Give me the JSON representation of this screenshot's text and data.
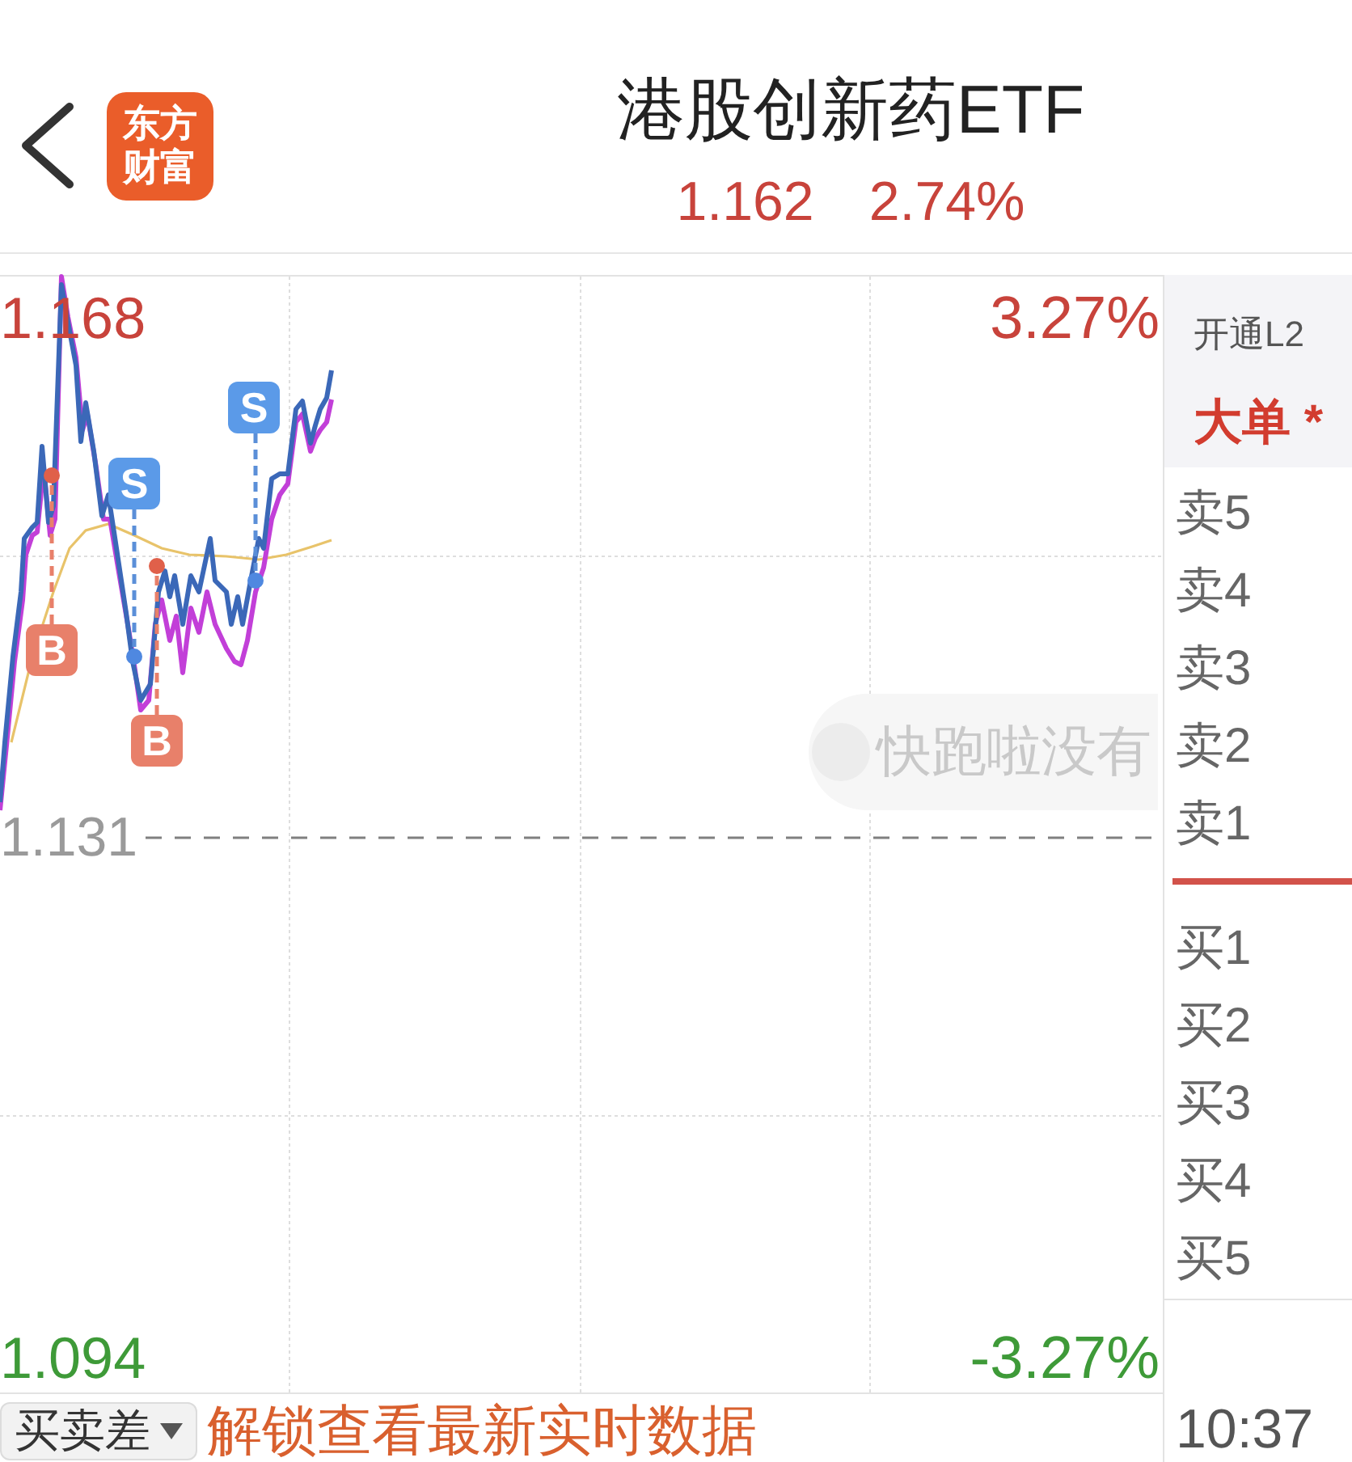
{
  "header": {
    "logo": {
      "lines": [
        "东方",
        "财富"
      ]
    },
    "title": "港股创新药ETF",
    "price": "1.162",
    "change_percent": "2.74%"
  },
  "chart": {
    "price_high": "1.168",
    "percent_high": "3.27%",
    "previous_close": "1.131",
    "price_low": "1.094",
    "percent_low": "-3.27%",
    "trade_markers": [
      {
        "kind": "buy",
        "label": "B"
      },
      {
        "kind": "sell",
        "label": "S"
      },
      {
        "kind": "buy",
        "label": "B"
      },
      {
        "kind": "sell",
        "label": "S"
      }
    ],
    "comment": {
      "text": "快跑啦没有"
    }
  },
  "order_book": {
    "promo": "开通L2",
    "big_order": "大单 *",
    "asks": [
      "卖5",
      "卖4",
      "卖3",
      "卖2",
      "卖1"
    ],
    "bids": [
      "买1",
      "买2",
      "买3",
      "买4",
      "买5"
    ],
    "time": "10:37"
  },
  "bottom_bar": {
    "selector": "买卖差",
    "unlock_link": "解锁查看最新实时数据"
  }
}
